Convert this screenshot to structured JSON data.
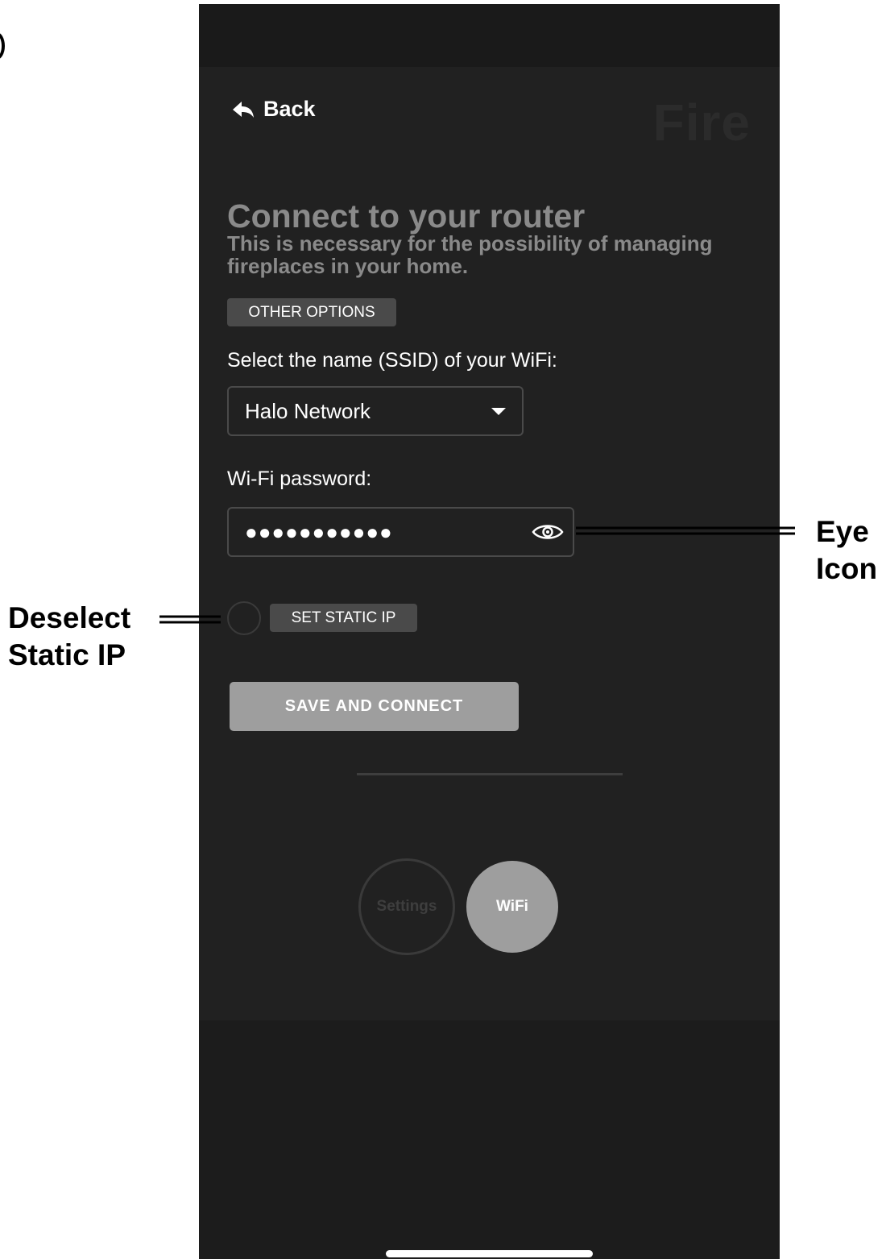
{
  "header": {
    "back_label": "Back",
    "brand_title": "Fire"
  },
  "main": {
    "heading": "Connect to your router",
    "subheading": "This is necessary for the possibility of managing fireplaces in your home.",
    "other_options_label": "OTHER OPTIONS",
    "ssid_label": "Select the name (SSID) of your WiFi:",
    "ssid_value": "Halo Network",
    "password_label": "Wi-Fi password:",
    "password_value": "●●●●●●●●●●●",
    "static_ip_label": "SET STATIC IP",
    "static_ip_selected": false,
    "save_label": "SAVE AND CONNECT"
  },
  "bottom_nav": {
    "items": [
      {
        "label": "Settings",
        "active": false
      },
      {
        "label": "WiFi",
        "active": true
      }
    ]
  },
  "annotations": {
    "eye": {
      "line1": "Eye",
      "line2": "Icon"
    },
    "static": {
      "line1": "Deselect",
      "line2": "Static IP"
    }
  },
  "colors": {
    "panel": "#212121",
    "button_gray": "#9e9e9e",
    "chip_gray": "#4a4a4a",
    "text_muted": "#8a8a8a"
  }
}
